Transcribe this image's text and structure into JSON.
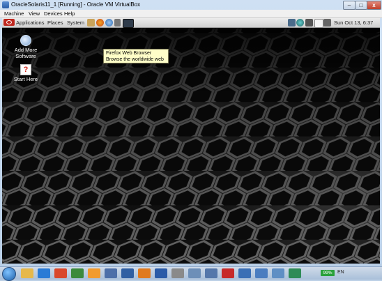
{
  "window": {
    "title": "OracleSolaris11_1 [Running] - Oracle VM VirtualBox",
    "controls": {
      "minimize": "–",
      "maximize": "□",
      "close": "x"
    }
  },
  "vbox_menu": [
    "Machine",
    "View",
    "Devices",
    "Help"
  ],
  "gnome_panel": {
    "menus": [
      "Applications",
      "Places",
      "System"
    ],
    "clock": "Sun Oct 13, 6:37"
  },
  "desktop_icons": [
    {
      "label_line1": "Add More",
      "label_line2": "Software",
      "icon": "software-icon"
    },
    {
      "label_line1": "Start Here",
      "icon": "help-icon"
    }
  ],
  "tooltip": {
    "line1": "Firefox Web Browser",
    "line2": "Browse the worldwide web"
  },
  "taskbar": {
    "battery": "99%",
    "tray_text": "EN"
  },
  "colors": {
    "tooltip_bg": "#fffec8",
    "wallpaper": "#121212",
    "battery": "#2aa13b"
  }
}
